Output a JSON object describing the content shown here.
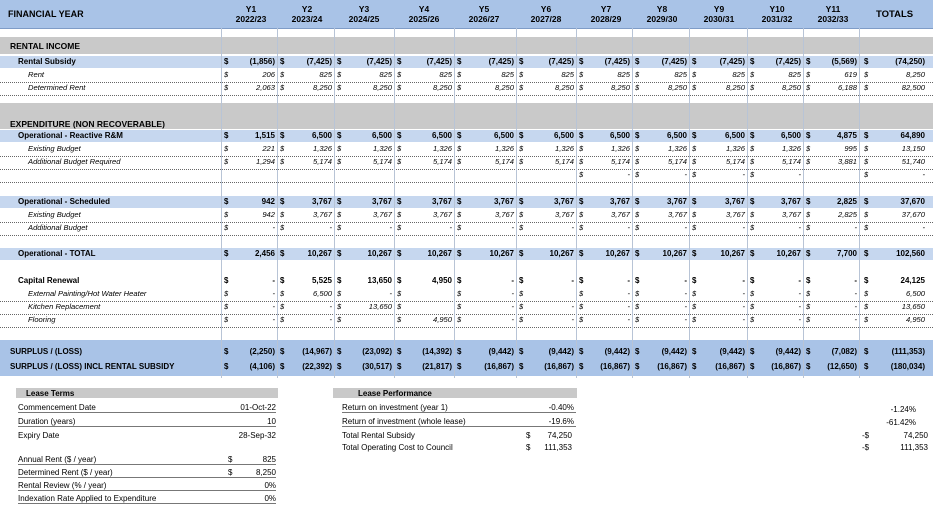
{
  "header": {
    "financial_year": "FINANCIAL YEAR",
    "years": [
      {
        "y": "Y1",
        "period": "2022/23"
      },
      {
        "y": "Y2",
        "period": "2023/24"
      },
      {
        "y": "Y3",
        "period": "2024/25"
      },
      {
        "y": "Y4",
        "period": "2025/26"
      },
      {
        "y": "Y5",
        "period": "2026/27"
      },
      {
        "y": "Y6",
        "period": "2027/28"
      },
      {
        "y": "Y7",
        "period": "2028/29"
      },
      {
        "y": "Y8",
        "period": "2029/30"
      },
      {
        "y": "Y9",
        "period": "2030/31"
      },
      {
        "y": "Y10",
        "period": "2031/32"
      },
      {
        "y": "Y11",
        "period": "2032/33"
      }
    ],
    "totals": "TOTALS"
  },
  "sections": {
    "rental_income": "RENTAL INCOME",
    "expenditure": "EXPENDITURE (NON RECOVERABLE)"
  },
  "rows": [
    {
      "key": "rental_subsidy",
      "label": "Rental Subsidy",
      "style": "bold",
      "values": [
        "(1,856)",
        "(7,425)",
        "(7,425)",
        "(7,425)",
        "(7,425)",
        "(7,425)",
        "(7,425)",
        "(7,425)",
        "(7,425)",
        "(7,425)",
        "(5,569)"
      ],
      "total": "(74,250)"
    },
    {
      "key": "rent",
      "label": "Rent",
      "style": "sub",
      "values": [
        "206",
        "825",
        "825",
        "825",
        "825",
        "825",
        "825",
        "825",
        "825",
        "825",
        "619"
      ],
      "total": "8,250"
    },
    {
      "key": "determined_rent",
      "label": "Determined Rent",
      "style": "sub",
      "values": [
        "2,063",
        "8,250",
        "8,250",
        "8,250",
        "8,250",
        "8,250",
        "8,250",
        "8,250",
        "8,250",
        "8,250",
        "6,188"
      ],
      "total": "82,500"
    },
    {
      "key": "op_reactive",
      "label": "Operational - Reactive R&M",
      "style": "bold",
      "values": [
        "1,515",
        "6,500",
        "6,500",
        "6,500",
        "6,500",
        "6,500",
        "6,500",
        "6,500",
        "6,500",
        "6,500",
        "4,875"
      ],
      "total": "64,890"
    },
    {
      "key": "existing_budget_1",
      "label": "Existing Budget",
      "style": "sub",
      "values": [
        "221",
        "1,326",
        "1,326",
        "1,326",
        "1,326",
        "1,326",
        "1,326",
        "1,326",
        "1,326",
        "1,326",
        "995"
      ],
      "total": "13,150"
    },
    {
      "key": "additional_budget_required",
      "label": "Additional Budget Required",
      "style": "sub",
      "values": [
        "1,294",
        "5,174",
        "5,174",
        "5,174",
        "5,174",
        "5,174",
        "5,174",
        "5,174",
        "5,174",
        "5,174",
        "3,881"
      ],
      "total": "51,740"
    },
    {
      "key": "blank_row",
      "label": "",
      "style": "sub",
      "values": [
        "",
        "",
        "",
        "",
        "",
        "",
        "-",
        "-",
        "-",
        "-",
        ""
      ],
      "total": "-"
    },
    {
      "key": "op_scheduled",
      "label": "Operational - Scheduled",
      "style": "bold",
      "values": [
        "942",
        "3,767",
        "3,767",
        "3,767",
        "3,767",
        "3,767",
        "3,767",
        "3,767",
        "3,767",
        "3,767",
        "2,825"
      ],
      "total": "37,670"
    },
    {
      "key": "existing_budget_2",
      "label": "Existing Budget",
      "style": "sub",
      "values": [
        "942",
        "3,767",
        "3,767",
        "3,767",
        "3,767",
        "3,767",
        "3,767",
        "3,767",
        "3,767",
        "3,767",
        "2,825"
      ],
      "total": "37,670"
    },
    {
      "key": "additional_budget",
      "label": "Additional Budget",
      "style": "sub",
      "values": [
        "-",
        "-",
        "-",
        "-",
        "-",
        "-",
        "-",
        "-",
        "-",
        "-",
        "-"
      ],
      "total": "-"
    },
    {
      "key": "op_total",
      "label": "Operational - TOTAL",
      "style": "bold",
      "values": [
        "2,456",
        "10,267",
        "10,267",
        "10,267",
        "10,267",
        "10,267",
        "10,267",
        "10,267",
        "10,267",
        "10,267",
        "7,700"
      ],
      "total": "102,560"
    },
    {
      "key": "capital_renewal",
      "label": "Capital Renewal",
      "style": "bold",
      "values": [
        "-",
        "5,525",
        "13,650",
        "4,950",
        "-",
        "-",
        "-",
        "-",
        "-",
        "-",
        "-"
      ],
      "total": "24,125"
    },
    {
      "key": "ext_painting",
      "label": "External Painting/Hot Water Heater",
      "style": "sub",
      "values": [
        "-",
        "6,500",
        "-",
        "",
        "-",
        "",
        "-",
        "-",
        "-",
        "-",
        "-"
      ],
      "total": "6,500"
    },
    {
      "key": "kitchen",
      "label": "Kitchen Replacement",
      "style": "sub",
      "values": [
        "-",
        "-",
        "13,650",
        "",
        "-",
        "-",
        "-",
        "-",
        "-",
        "-",
        "-"
      ],
      "total": "13,650"
    },
    {
      "key": "flooring",
      "label": "Flooring",
      "style": "sub",
      "values": [
        "-",
        "-",
        "",
        "4,950",
        "-",
        "-",
        "-",
        "-",
        "-",
        "-",
        "-"
      ],
      "total": "4,950"
    },
    {
      "key": "surplus",
      "label": "SURPLUS / (LOSS)",
      "style": "bold",
      "values": [
        "(2,250)",
        "(14,967)",
        "(23,092)",
        "(14,392)",
        "(9,442)",
        "(9,442)",
        "(9,442)",
        "(9,442)",
        "(9,442)",
        "(9,442)",
        "(7,082)"
      ],
      "total": "(111,353)"
    },
    {
      "key": "surplus_subsidy",
      "label": "SURPLUS / (LOSS) INCL RENTAL SUBSIDY",
      "style": "bold",
      "values": [
        "(4,106)",
        "(22,392)",
        "(30,517)",
        "(21,817)",
        "(16,867)",
        "(16,867)",
        "(16,867)",
        "(16,867)",
        "(16,867)",
        "(16,867)",
        "(12,650)"
      ],
      "total": "(180,034)"
    }
  ],
  "lease_terms": {
    "title": "Lease Terms",
    "commencement_label": "Commencement Date",
    "commencement": "01-Oct-22",
    "duration_label": "Duration (years)",
    "duration": "10",
    "expiry_label": "Expiry Date",
    "expiry": "28-Sep-32",
    "annual_rent_label": "Annual Rent ($ / year)",
    "annual_rent": "825",
    "determined_rent_label": "Determined Rent ($ / year)",
    "determined_rent": "8,250",
    "rental_review_label": "Rental Review (% / year)",
    "rental_review": "0%",
    "indexation_label": "Indexation Rate Applied to Expenditure",
    "indexation": "0%",
    "currency": "$"
  },
  "lease_performance": {
    "title": "Lease Performance",
    "roi_year1_label": "Return on investment (year 1)",
    "roi_year1": "-0.40%",
    "roi_whole_label": "Return of investment (whole lease)",
    "roi_whole": "-19.6%",
    "total_subsidy_label": "Total Rental Subsidy",
    "total_subsidy": "74,250",
    "total_cost_label": "Total Operating Cost to Council",
    "total_cost": "111,353",
    "currency": "$"
  },
  "right_summary": {
    "roi_year1": "-1.24%",
    "roi_whole": "-61.42%",
    "total_subsidy_prefix": "-$",
    "total_subsidy": "74,250",
    "total_cost_prefix": "-$",
    "total_cost": "111,353"
  }
}
